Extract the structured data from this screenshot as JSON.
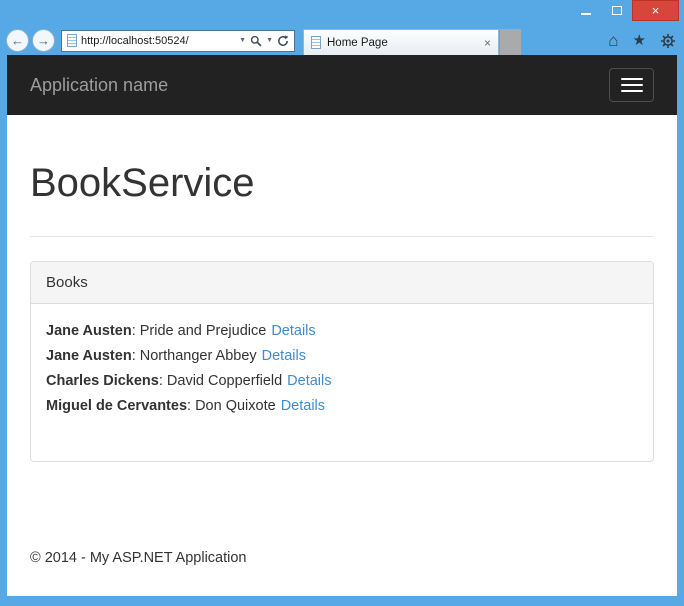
{
  "window": {
    "close_glyph": "×"
  },
  "browser": {
    "back_glyph": "←",
    "forward_glyph": "→",
    "address": {
      "url": "http://localhost:50524/",
      "caret_glyph": "▼",
      "search_caret_glyph": "▼"
    },
    "tab": {
      "title": "Home Page",
      "close_glyph": "×"
    },
    "toolbar": {
      "home_glyph": "⌂",
      "star_glyph": "★"
    }
  },
  "navbar": {
    "brand": "Application name"
  },
  "main": {
    "title": "BookService",
    "panel": {
      "heading": "Books",
      "separator": ": ",
      "books": [
        {
          "author": "Jane Austen",
          "title": "Pride and Prejudice",
          "details_label": "Details"
        },
        {
          "author": "Jane Austen",
          "title": "Northanger Abbey",
          "details_label": "Details"
        },
        {
          "author": "Charles Dickens",
          "title": "David Copperfield",
          "details_label": "Details"
        },
        {
          "author": "Miguel de Cervantes",
          "title": "Don Quixote",
          "details_label": "Details"
        }
      ]
    }
  },
  "footer": {
    "copyright": "© 2014 - My ASP.NET Application"
  },
  "colors": {
    "frame_blue": "#57a9e6",
    "close_red": "#d8453a",
    "navbar_bg": "#222222",
    "navbar_text": "#9d9d9d",
    "link_blue": "#428bca",
    "panel_border": "#dddddd",
    "panel_heading_bg": "#f5f5f5"
  }
}
